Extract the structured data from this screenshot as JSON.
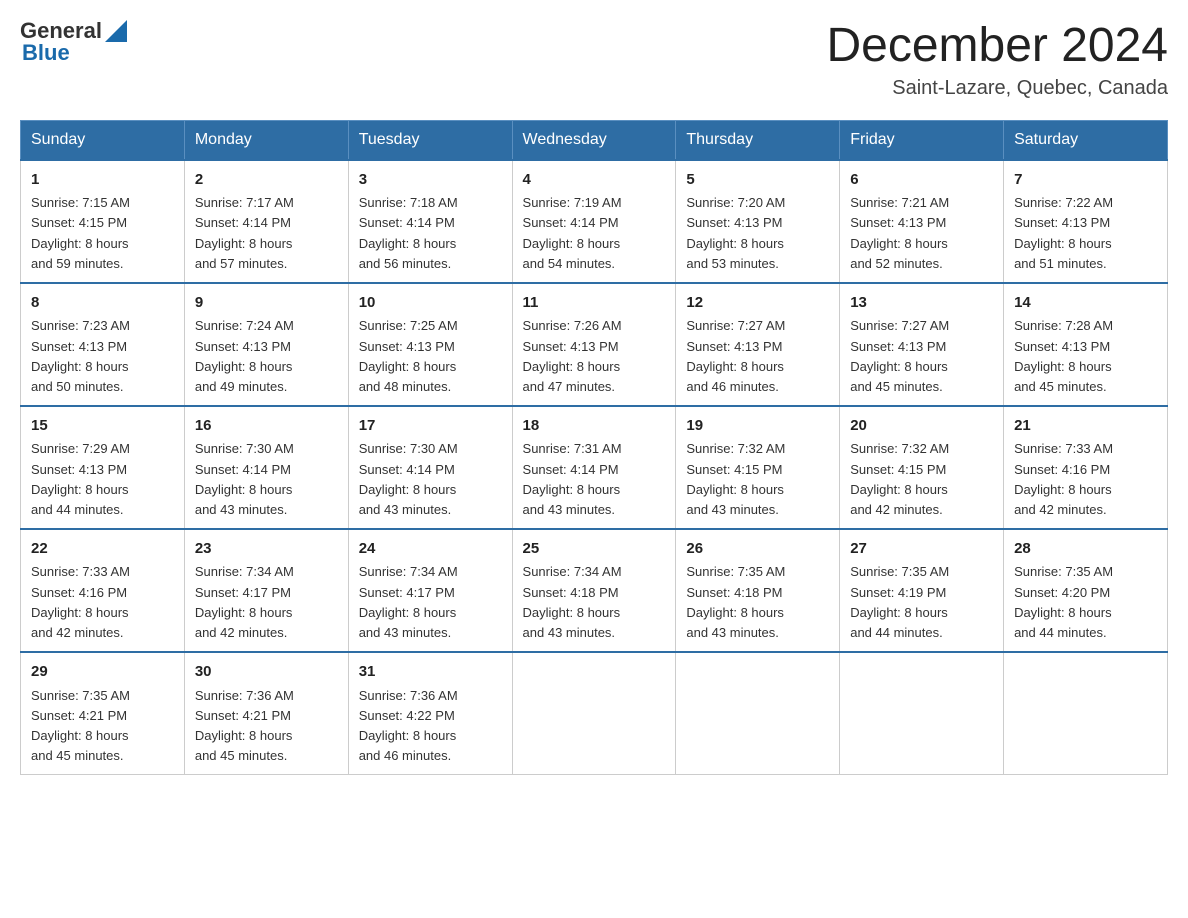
{
  "header": {
    "logo_general": "General",
    "logo_blue": "Blue",
    "month_title": "December 2024",
    "location": "Saint-Lazare, Quebec, Canada"
  },
  "weekdays": [
    "Sunday",
    "Monday",
    "Tuesday",
    "Wednesday",
    "Thursday",
    "Friday",
    "Saturday"
  ],
  "weeks": [
    [
      {
        "day": "1",
        "sunrise": "7:15 AM",
        "sunset": "4:15 PM",
        "daylight": "8 hours and 59 minutes."
      },
      {
        "day": "2",
        "sunrise": "7:17 AM",
        "sunset": "4:14 PM",
        "daylight": "8 hours and 57 minutes."
      },
      {
        "day": "3",
        "sunrise": "7:18 AM",
        "sunset": "4:14 PM",
        "daylight": "8 hours and 56 minutes."
      },
      {
        "day": "4",
        "sunrise": "7:19 AM",
        "sunset": "4:14 PM",
        "daylight": "8 hours and 54 minutes."
      },
      {
        "day": "5",
        "sunrise": "7:20 AM",
        "sunset": "4:13 PM",
        "daylight": "8 hours and 53 minutes."
      },
      {
        "day": "6",
        "sunrise": "7:21 AM",
        "sunset": "4:13 PM",
        "daylight": "8 hours and 52 minutes."
      },
      {
        "day": "7",
        "sunrise": "7:22 AM",
        "sunset": "4:13 PM",
        "daylight": "8 hours and 51 minutes."
      }
    ],
    [
      {
        "day": "8",
        "sunrise": "7:23 AM",
        "sunset": "4:13 PM",
        "daylight": "8 hours and 50 minutes."
      },
      {
        "day": "9",
        "sunrise": "7:24 AM",
        "sunset": "4:13 PM",
        "daylight": "8 hours and 49 minutes."
      },
      {
        "day": "10",
        "sunrise": "7:25 AM",
        "sunset": "4:13 PM",
        "daylight": "8 hours and 48 minutes."
      },
      {
        "day": "11",
        "sunrise": "7:26 AM",
        "sunset": "4:13 PM",
        "daylight": "8 hours and 47 minutes."
      },
      {
        "day": "12",
        "sunrise": "7:27 AM",
        "sunset": "4:13 PM",
        "daylight": "8 hours and 46 minutes."
      },
      {
        "day": "13",
        "sunrise": "7:27 AM",
        "sunset": "4:13 PM",
        "daylight": "8 hours and 45 minutes."
      },
      {
        "day": "14",
        "sunrise": "7:28 AM",
        "sunset": "4:13 PM",
        "daylight": "8 hours and 45 minutes."
      }
    ],
    [
      {
        "day": "15",
        "sunrise": "7:29 AM",
        "sunset": "4:13 PM",
        "daylight": "8 hours and 44 minutes."
      },
      {
        "day": "16",
        "sunrise": "7:30 AM",
        "sunset": "4:14 PM",
        "daylight": "8 hours and 43 minutes."
      },
      {
        "day": "17",
        "sunrise": "7:30 AM",
        "sunset": "4:14 PM",
        "daylight": "8 hours and 43 minutes."
      },
      {
        "day": "18",
        "sunrise": "7:31 AM",
        "sunset": "4:14 PM",
        "daylight": "8 hours and 43 minutes."
      },
      {
        "day": "19",
        "sunrise": "7:32 AM",
        "sunset": "4:15 PM",
        "daylight": "8 hours and 43 minutes."
      },
      {
        "day": "20",
        "sunrise": "7:32 AM",
        "sunset": "4:15 PM",
        "daylight": "8 hours and 42 minutes."
      },
      {
        "day": "21",
        "sunrise": "7:33 AM",
        "sunset": "4:16 PM",
        "daylight": "8 hours and 42 minutes."
      }
    ],
    [
      {
        "day": "22",
        "sunrise": "7:33 AM",
        "sunset": "4:16 PM",
        "daylight": "8 hours and 42 minutes."
      },
      {
        "day": "23",
        "sunrise": "7:34 AM",
        "sunset": "4:17 PM",
        "daylight": "8 hours and 42 minutes."
      },
      {
        "day": "24",
        "sunrise": "7:34 AM",
        "sunset": "4:17 PM",
        "daylight": "8 hours and 43 minutes."
      },
      {
        "day": "25",
        "sunrise": "7:34 AM",
        "sunset": "4:18 PM",
        "daylight": "8 hours and 43 minutes."
      },
      {
        "day": "26",
        "sunrise": "7:35 AM",
        "sunset": "4:18 PM",
        "daylight": "8 hours and 43 minutes."
      },
      {
        "day": "27",
        "sunrise": "7:35 AM",
        "sunset": "4:19 PM",
        "daylight": "8 hours and 44 minutes."
      },
      {
        "day": "28",
        "sunrise": "7:35 AM",
        "sunset": "4:20 PM",
        "daylight": "8 hours and 44 minutes."
      }
    ],
    [
      {
        "day": "29",
        "sunrise": "7:35 AM",
        "sunset": "4:21 PM",
        "daylight": "8 hours and 45 minutes."
      },
      {
        "day": "30",
        "sunrise": "7:36 AM",
        "sunset": "4:21 PM",
        "daylight": "8 hours and 45 minutes."
      },
      {
        "day": "31",
        "sunrise": "7:36 AM",
        "sunset": "4:22 PM",
        "daylight": "8 hours and 46 minutes."
      },
      null,
      null,
      null,
      null
    ]
  ],
  "labels": {
    "sunrise": "Sunrise:",
    "sunset": "Sunset:",
    "daylight": "Daylight:"
  }
}
